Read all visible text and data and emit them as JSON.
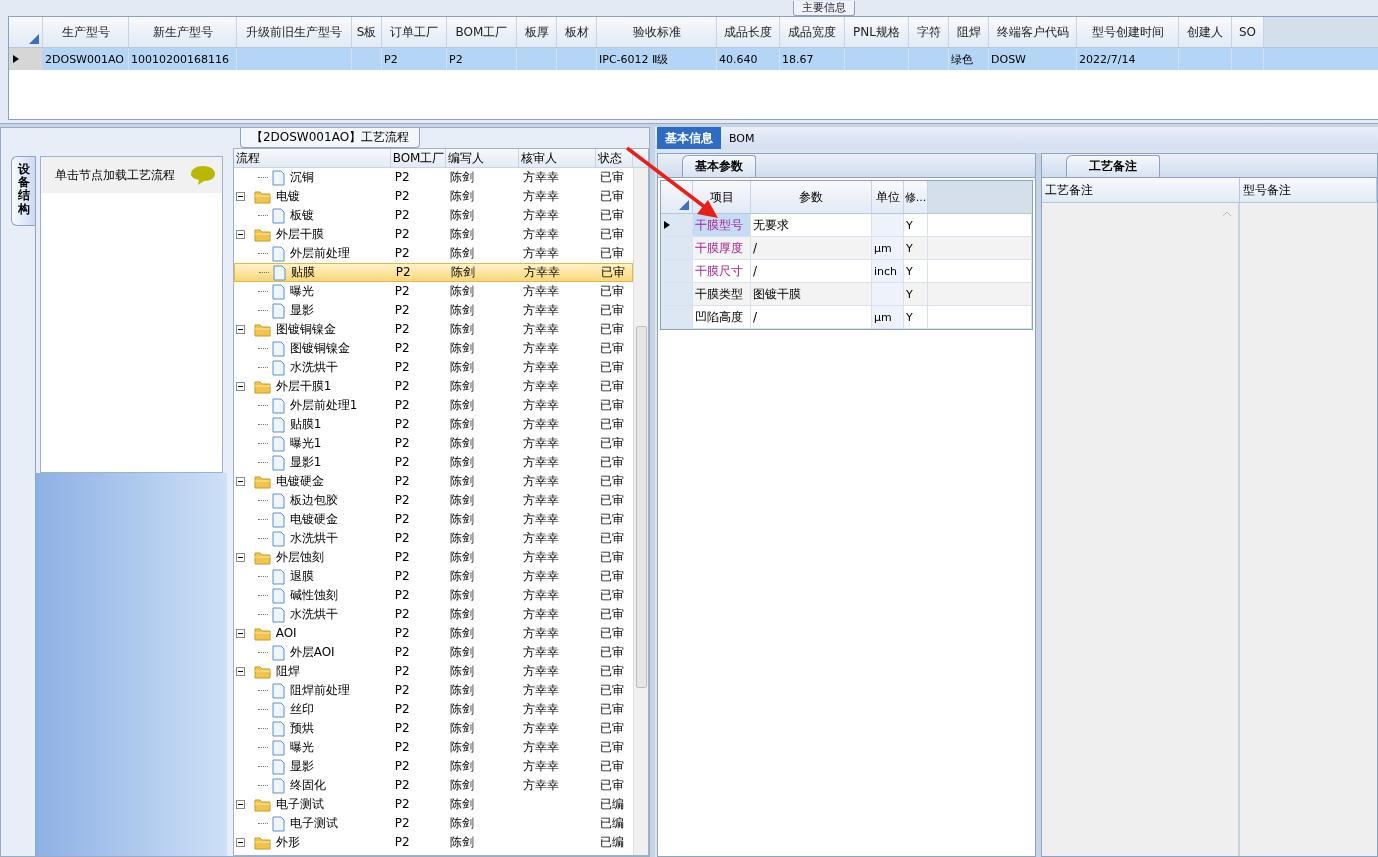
{
  "main_info": {
    "title": "主要信息",
    "row_selected": true,
    "columns": [
      {
        "header": "生产型号",
        "value": "2DOSW001AO"
      },
      {
        "header": "新生产型号",
        "value": "10010200168116"
      },
      {
        "header": "升级前旧生产型号"
      },
      {
        "header": "S板"
      },
      {
        "header": "订单工厂",
        "value": "P2"
      },
      {
        "header": "BOM工厂",
        "value": "P2"
      },
      {
        "header": "板厚"
      },
      {
        "header": "板材"
      },
      {
        "header": "验收标准",
        "value": "IPC-6012 Ⅱ级"
      },
      {
        "header": "成品长度",
        "value": "40.640"
      },
      {
        "header": "成品宽度",
        "value": "18.67"
      },
      {
        "header": "PNL规格"
      },
      {
        "header": "字符"
      },
      {
        "header": "阻焊",
        "value": "绿色"
      },
      {
        "header": "终端客户代码",
        "value": "DOSW"
      },
      {
        "header": "型号创建时间",
        "value": "2022/7/14"
      },
      {
        "header": "创建人"
      },
      {
        "header": "SO"
      }
    ]
  },
  "flow": {
    "title": "【2DOSW001AO】工艺流程",
    "side_tab": "设备结构",
    "hint": "单击节点加载工艺流程",
    "columns": [
      "流程",
      "BOM工厂",
      "编写人",
      "核审人",
      "状态"
    ],
    "rows": [
      {
        "children": [
          {
            "kind": "step",
            "name": "沉铜",
            "bom": "P2",
            "writer": "陈剑",
            "reviewer": "方幸幸",
            "status": "已审",
            "selected": false
          }
        ]
      },
      {
        "kind": "folder",
        "name": "电镀",
        "bom": "P2",
        "writer": "陈剑",
        "reviewer": "方幸幸",
        "status": "已审",
        "selected": false,
        "expanded": true,
        "children": [
          {
            "kind": "step",
            "name": "板镀",
            "bom": "P2",
            "writer": "陈剑",
            "reviewer": "方幸幸",
            "status": "已审",
            "selected": false
          }
        ]
      },
      {
        "kind": "folder",
        "name": "外层干膜",
        "bom": "P2",
        "writer": "陈剑",
        "reviewer": "方幸幸",
        "status": "已审",
        "selected": false,
        "expanded": true,
        "children": [
          {
            "kind": "step",
            "name": "外层前处理",
            "bom": "P2",
            "writer": "陈剑",
            "reviewer": "方幸幸",
            "status": "已审",
            "selected": false
          },
          {
            "kind": "step",
            "name": "贴膜",
            "bom": "P2",
            "writer": "陈剑",
            "reviewer": "方幸幸",
            "status": "已审",
            "selected": true
          },
          {
            "kind": "step",
            "name": "曝光",
            "bom": "P2",
            "writer": "陈剑",
            "reviewer": "方幸幸",
            "status": "已审",
            "selected": false
          },
          {
            "kind": "step",
            "name": "显影",
            "bom": "P2",
            "writer": "陈剑",
            "reviewer": "方幸幸",
            "status": "已审",
            "selected": false
          }
        ]
      },
      {
        "kind": "folder",
        "name": "图镀铜镍金",
        "bom": "P2",
        "writer": "陈剑",
        "reviewer": "方幸幸",
        "status": "已审",
        "selected": false,
        "expanded": true,
        "children": [
          {
            "kind": "step",
            "name": "图镀铜镍金",
            "bom": "P2",
            "writer": "陈剑",
            "reviewer": "方幸幸",
            "status": "已审",
            "selected": false
          },
          {
            "kind": "step",
            "name": "水洗烘干",
            "bom": "P2",
            "writer": "陈剑",
            "reviewer": "方幸幸",
            "status": "已审",
            "selected": false
          }
        ]
      },
      {
        "kind": "folder",
        "name": "外层干膜1",
        "bom": "P2",
        "writer": "陈剑",
        "reviewer": "方幸幸",
        "status": "已审",
        "selected": false,
        "expanded": true,
        "children": [
          {
            "kind": "step",
            "name": "外层前处理1",
            "bom": "P2",
            "writer": "陈剑",
            "reviewer": "方幸幸",
            "status": "已审",
            "selected": false
          },
          {
            "kind": "step",
            "name": "贴膜1",
            "bom": "P2",
            "writer": "陈剑",
            "reviewer": "方幸幸",
            "status": "已审",
            "selected": false
          },
          {
            "kind": "step",
            "name": "曝光1",
            "bom": "P2",
            "writer": "陈剑",
            "reviewer": "方幸幸",
            "status": "已审",
            "selected": false
          },
          {
            "kind": "step",
            "name": "显影1",
            "bom": "P2",
            "writer": "陈剑",
            "reviewer": "方幸幸",
            "status": "已审",
            "selected": false
          }
        ]
      },
      {
        "kind": "folder",
        "name": "电镀硬金",
        "bom": "P2",
        "writer": "陈剑",
        "reviewer": "方幸幸",
        "status": "已审",
        "selected": false,
        "expanded": true,
        "children": [
          {
            "kind": "step",
            "name": "板边包胶",
            "bom": "P2",
            "writer": "陈剑",
            "reviewer": "方幸幸",
            "status": "已审",
            "selected": false
          },
          {
            "kind": "step",
            "name": "电镀硬金",
            "bom": "P2",
            "writer": "陈剑",
            "reviewer": "方幸幸",
            "status": "已审",
            "selected": false
          },
          {
            "kind": "step",
            "name": "水洗烘干",
            "bom": "P2",
            "writer": "陈剑",
            "reviewer": "方幸幸",
            "status": "已审",
            "selected": false
          }
        ]
      },
      {
        "kind": "folder",
        "name": "外层蚀刻",
        "bom": "P2",
        "writer": "陈剑",
        "reviewer": "方幸幸",
        "status": "已审",
        "selected": false,
        "expanded": true,
        "children": [
          {
            "kind": "step",
            "name": "退膜",
            "bom": "P2",
            "writer": "陈剑",
            "reviewer": "方幸幸",
            "status": "已审",
            "selected": false
          },
          {
            "kind": "step",
            "name": "碱性蚀刻",
            "bom": "P2",
            "writer": "陈剑",
            "reviewer": "方幸幸",
            "status": "已审",
            "selected": false
          },
          {
            "kind": "step",
            "name": "水洗烘干",
            "bom": "P2",
            "writer": "陈剑",
            "reviewer": "方幸幸",
            "status": "已审",
            "selected": false
          }
        ]
      },
      {
        "kind": "folder",
        "name": "AOI",
        "bom": "P2",
        "writer": "陈剑",
        "reviewer": "方幸幸",
        "status": "已审",
        "selected": false,
        "expanded": true,
        "children": [
          {
            "kind": "step",
            "name": "外层AOI",
            "bom": "P2",
            "writer": "陈剑",
            "reviewer": "方幸幸",
            "status": "已审",
            "selected": false
          }
        ]
      },
      {
        "kind": "folder",
        "name": "阻焊",
        "bom": "P2",
        "writer": "陈剑",
        "reviewer": "方幸幸",
        "status": "已审",
        "selected": false,
        "expanded": true,
        "children": [
          {
            "kind": "step",
            "name": "阻焊前处理",
            "bom": "P2",
            "writer": "陈剑",
            "reviewer": "方幸幸",
            "status": "已审",
            "selected": false
          },
          {
            "kind": "step",
            "name": "丝印",
            "bom": "P2",
            "writer": "陈剑",
            "reviewer": "方幸幸",
            "status": "已审",
            "selected": false
          },
          {
            "kind": "step",
            "name": "预烘",
            "bom": "P2",
            "writer": "陈剑",
            "reviewer": "方幸幸",
            "status": "已审",
            "selected": false
          },
          {
            "kind": "step",
            "name": "曝光",
            "bom": "P2",
            "writer": "陈剑",
            "reviewer": "方幸幸",
            "status": "已审",
            "selected": false
          },
          {
            "kind": "step",
            "name": "显影",
            "bom": "P2",
            "writer": "陈剑",
            "reviewer": "方幸幸",
            "status": "已审",
            "selected": false
          },
          {
            "kind": "step",
            "name": "终固化",
            "bom": "P2",
            "writer": "陈剑",
            "reviewer": "方幸幸",
            "status": "已审",
            "selected": false
          }
        ]
      },
      {
        "kind": "folder",
        "name": "电子测试",
        "bom": "P2",
        "writer": "陈剑",
        "status": "已编",
        "selected": false,
        "expanded": true,
        "children": [
          {
            "kind": "step",
            "name": "电子测试",
            "bom": "P2",
            "writer": "陈剑",
            "status": "已编",
            "selected": false
          }
        ]
      },
      {
        "kind": "folder",
        "name": "外形",
        "bom": "P2",
        "writer": "陈剑",
        "status": "已编",
        "selected": false,
        "expanded": true
      }
    ]
  },
  "detail": {
    "tabs": [
      {
        "label": "基本信息",
        "selected": true
      },
      {
        "label": "BOM",
        "selected": false
      }
    ],
    "params": {
      "tab": "基本参数",
      "columns": [
        "项目",
        "参数",
        "单位",
        "修..."
      ],
      "rows": [
        {
          "item": "干膜型号",
          "value": "无要求",
          "mod": "Y",
          "required": true,
          "current": true
        },
        {
          "item": "干膜厚度",
          "value": "/",
          "unit": "μm",
          "mod": "Y",
          "required": true,
          "current": false
        },
        {
          "item": "干膜尺寸",
          "value": "/",
          "unit": "inch",
          "mod": "Y",
          "required": true,
          "current": false
        },
        {
          "item": "干膜类型",
          "value": "图镀干膜",
          "mod": "Y",
          "required": false,
          "current": false
        },
        {
          "item": "凹陷高度",
          "value": "/",
          "unit": "μm",
          "mod": "Y",
          "required": false,
          "current": false
        }
      ]
    },
    "notes": {
      "tab": "工艺备注",
      "columns": [
        "工艺备注",
        "型号备注"
      ]
    }
  }
}
